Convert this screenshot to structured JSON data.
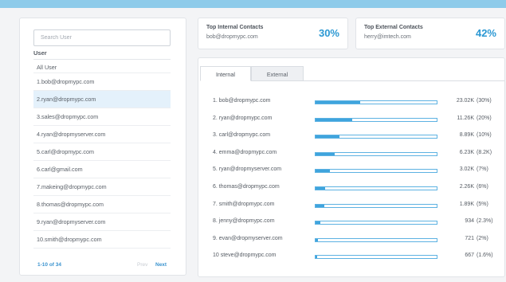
{
  "colors": {
    "accent": "#2b98d3",
    "bar_fill": "#3fa4dd",
    "selected_row": "#e4f1fb",
    "top_bar": "#8ecbea"
  },
  "sidebar": {
    "search_placeholder": "Search User",
    "header": "User",
    "all_label": "All User",
    "items": [
      "1.bob@dropmypc.com",
      "2.ryan@dropmypc.com",
      "3.sales@dropmypc.com",
      "4.ryan@dropmyserver.com",
      "5.carl@dropmypc.com",
      "6.carl@gmail.com",
      "7.makeing@dropmypc.com",
      "8.thomas@dropmypc.com",
      "9.ryan@dropmyserver.com",
      "10.smith@dropmypc.com"
    ],
    "selected_index": 1,
    "pager": {
      "range": "1-10 of 34",
      "prev": "Prev",
      "next": "Next"
    }
  },
  "cards": {
    "internal": {
      "title": "Top Internal Contacts",
      "email": "bob@dropmypc.com",
      "percent": "30%"
    },
    "external": {
      "title": "Top External Contacts",
      "email": "herry@imtech.com",
      "percent": "42%"
    }
  },
  "tabs": {
    "internal": "Internal",
    "external": "External"
  },
  "contacts": [
    {
      "name": "1. bob@dropmypc.com",
      "count": "23.02K",
      "share": "(30%)",
      "level": 0.37
    },
    {
      "name": "2. ryan@dropmypc.com",
      "count": "11.26K",
      "share": "(20%)",
      "level": 0.3
    },
    {
      "name": "3. carl@dropmypc.com",
      "count": "8.89K",
      "share": "(10%)",
      "level": 0.2
    },
    {
      "name": "4. emma@dropmypc.com",
      "count": "6.23K",
      "share": "(8.2K)",
      "level": 0.16
    },
    {
      "name": "5. ryan@dropmyserver.com",
      "count": "3.02K",
      "share": "(7%)",
      "level": 0.12
    },
    {
      "name": "6. thomas@dropmypc.com",
      "count": "2.26K",
      "share": "(6%)",
      "level": 0.08
    },
    {
      "name": "7. smith@dropmypc.com",
      "count": "1.89K",
      "share": "(5%)",
      "level": 0.07
    },
    {
      "name": "8. jenny@dropmypc.com",
      "count": "934",
      "share": "(2.3%)",
      "level": 0.04
    },
    {
      "name": "9. evan@dropmyserver.com",
      "count": "721",
      "share": "(2%)",
      "level": 0.02
    },
    {
      "name": "10 steve@dropmypc.com",
      "count": "667",
      "share": "(1.6%)",
      "level": 0.015
    }
  ]
}
